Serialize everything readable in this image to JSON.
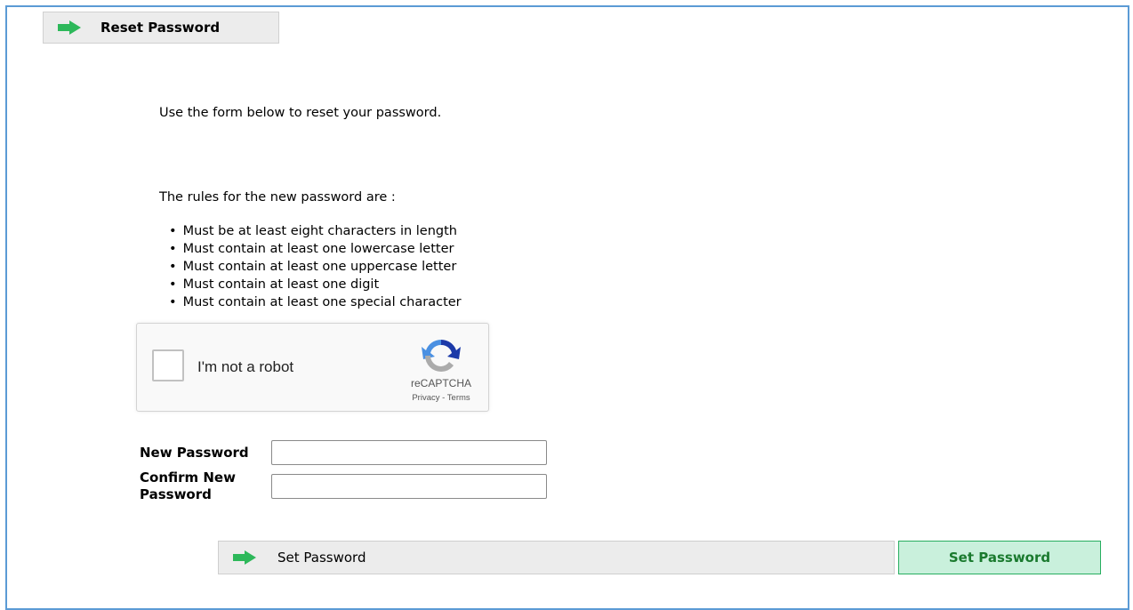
{
  "header": {
    "title": "Reset Password",
    "icon": "arrow-right-icon"
  },
  "intro_text": "Use the form below to reset your password.",
  "rules": {
    "title": "The rules for the new password are :",
    "items": [
      "Must be at least eight characters in length",
      "Must contain at least one lowercase letter",
      "Must contain at least one uppercase letter",
      "Must contain at least one digit",
      "Must contain at least one special character"
    ]
  },
  "captcha": {
    "label": "I'm not a robot",
    "brand": "reCAPTCHA",
    "privacy": "Privacy",
    "separator": " - ",
    "terms": "Terms",
    "checked": false
  },
  "form": {
    "new_password_label": "New Password",
    "new_password_value": "",
    "confirm_password_label": "Confirm New Password",
    "confirm_password_value": ""
  },
  "actions": {
    "bar_label": "Set Password",
    "submit_label": "Set Password"
  },
  "colors": {
    "frame_border": "#5b9bd5",
    "arrow": "#2db85a",
    "submit_bg": "#c9f0dc",
    "submit_border": "#27ae60",
    "submit_text": "#1a7a2e"
  }
}
